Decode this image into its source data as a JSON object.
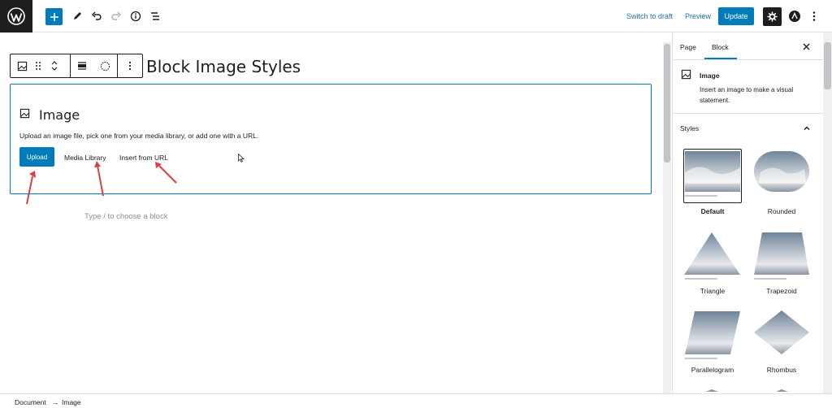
{
  "topbar": {
    "switch_to_draft": "Switch to draft",
    "preview": "Preview",
    "update": "Update",
    "accent": "#007cba"
  },
  "editor": {
    "post_title": "Block Image Styles",
    "image_block": {
      "title": "Image",
      "description": "Upload an image file, pick one from your media library, or add one with a URL.",
      "upload": "Upload",
      "media_library": "Media Library",
      "insert_from_url": "Insert from URL"
    },
    "placeholder": "Type / to choose a block"
  },
  "sidebar": {
    "tabs": [
      {
        "label": "Page"
      },
      {
        "label": "Block"
      }
    ],
    "block_name": "Image",
    "block_description": "Insert an image to make a visual statement.",
    "styles_heading": "Styles",
    "styles": [
      {
        "label": "Default"
      },
      {
        "label": "Rounded"
      },
      {
        "label": "Triangle"
      },
      {
        "label": "Trapezoid"
      },
      {
        "label": "Parallelogram"
      },
      {
        "label": "Rhombus"
      }
    ]
  },
  "breadcrumb": {
    "items": [
      "Document",
      "Image"
    ],
    "separator": "→"
  }
}
